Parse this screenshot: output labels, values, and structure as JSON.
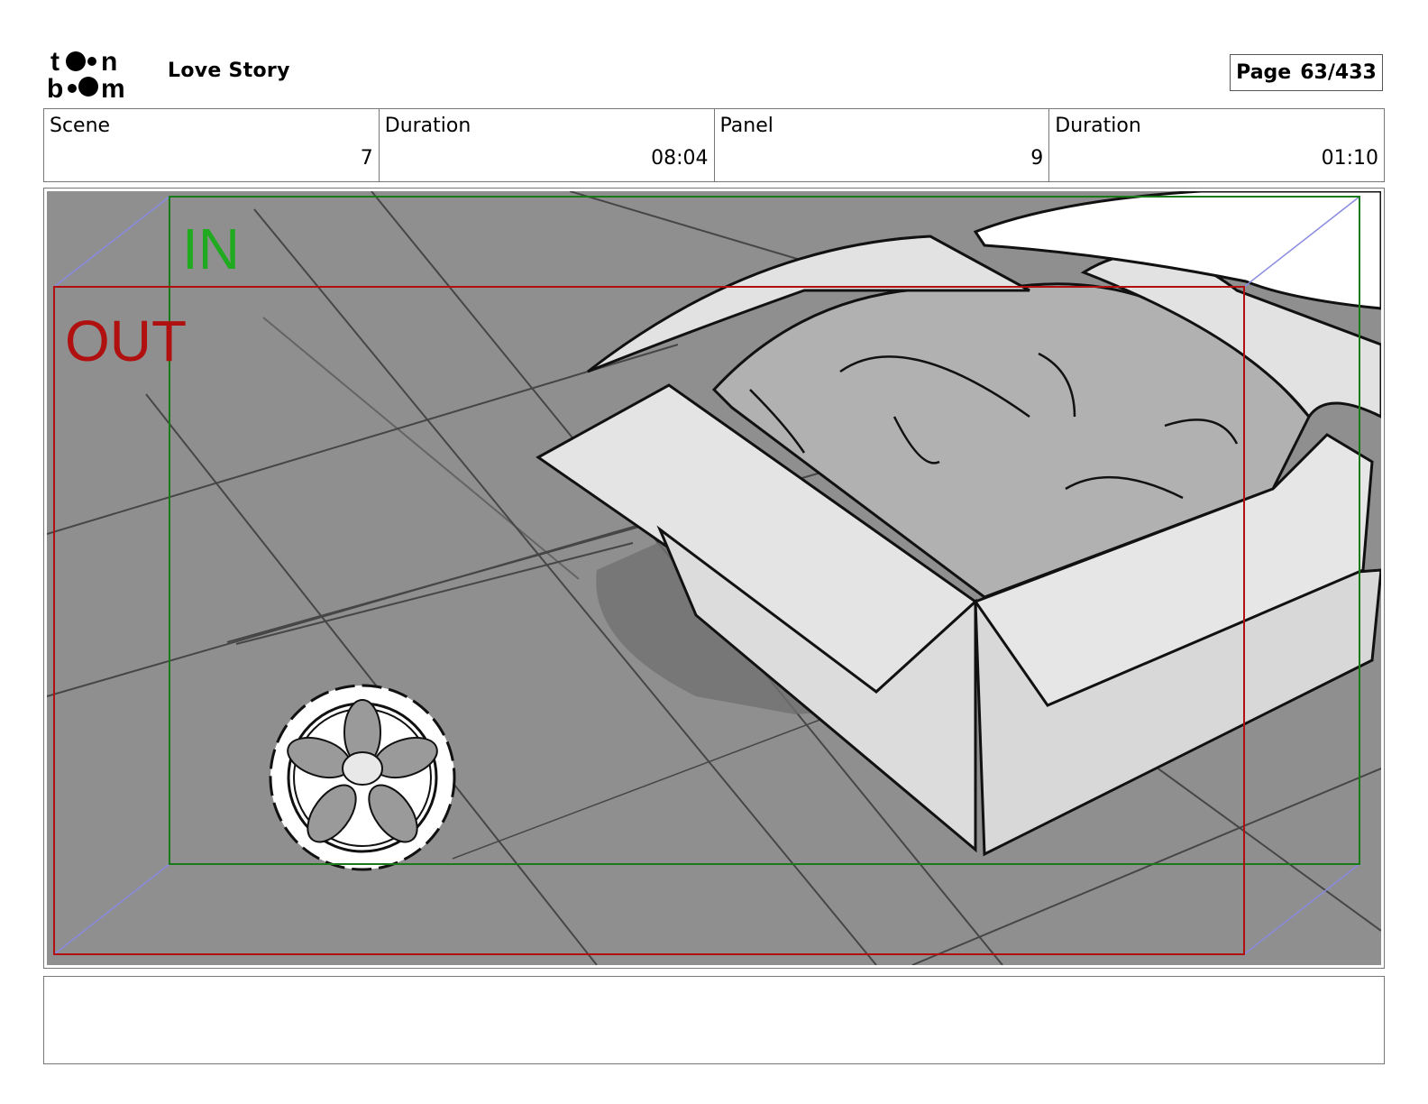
{
  "header": {
    "logo_text": "toon boom",
    "project_title": "Love Story",
    "page_label": "Page",
    "page_value": "63/433"
  },
  "info": {
    "scene_label": "Scene",
    "scene_value": "7",
    "scene_duration_label": "Duration",
    "scene_duration_value": "08:04",
    "panel_label": "Panel",
    "panel_value": "9",
    "panel_duration_label": "Duration",
    "panel_duration_value": "01:10"
  },
  "frame_labels": {
    "in_label": "IN",
    "out_label": "OUT",
    "in_color": "#1faa1f",
    "out_color": "#b01010"
  },
  "notes": {
    "text": ""
  }
}
